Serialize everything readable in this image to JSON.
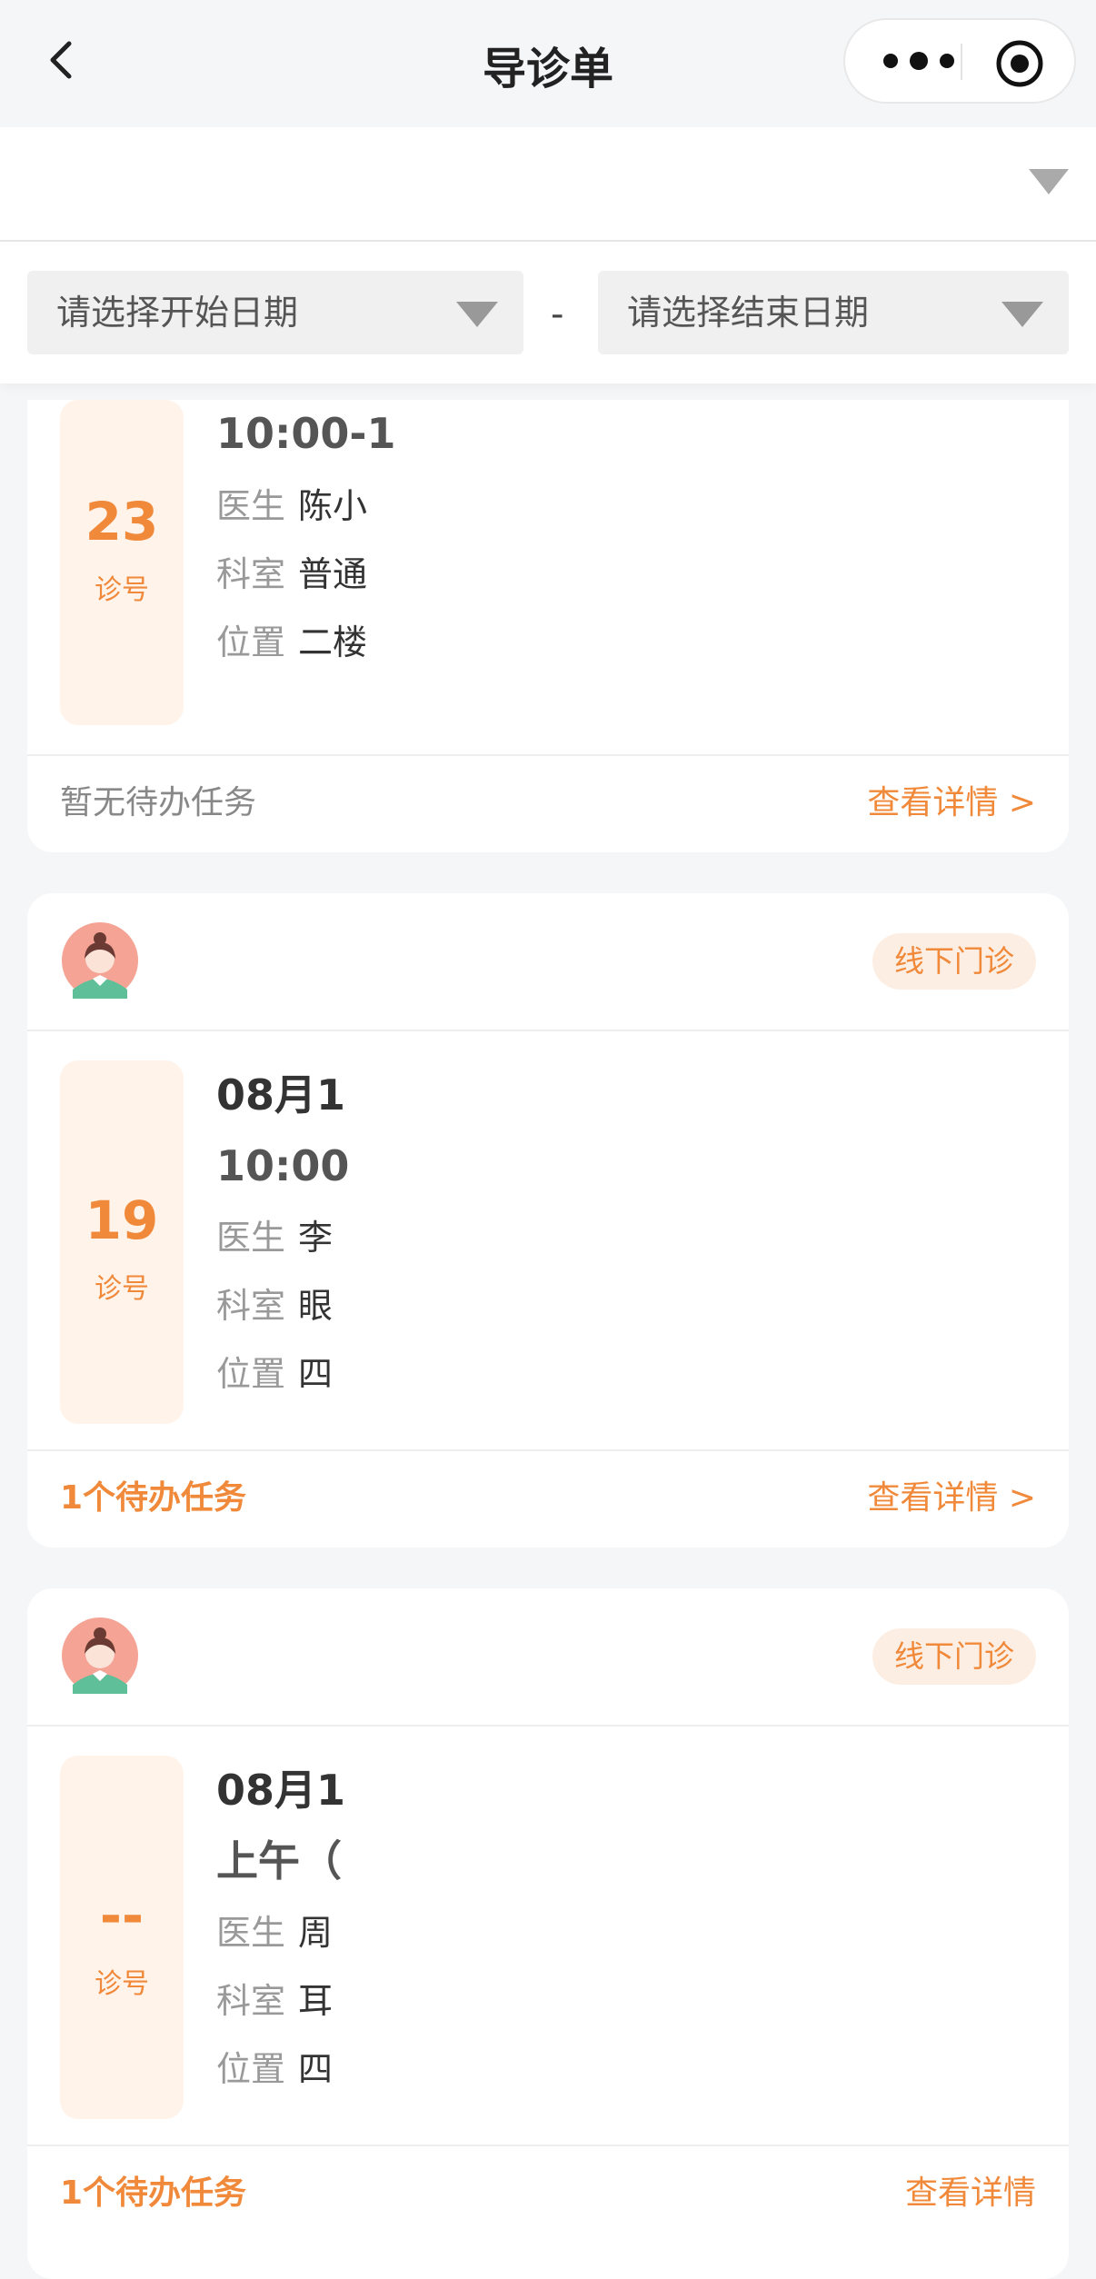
{
  "header": {
    "title": "导诊单"
  },
  "filter": {
    "start_placeholder": "请选择开始日期",
    "separator": "-",
    "end_placeholder": "请选择结束日期"
  },
  "cards": [
    {
      "number": "23",
      "number_label": "诊号",
      "time": "10:00-1",
      "doctor_key": "医生",
      "doctor": "陈小",
      "dept_key": "科室",
      "dept": "普通",
      "loc_key": "位置",
      "loc": "二楼",
      "task_text": "暂无待办任务",
      "detail_link": "查看详情 >"
    },
    {
      "tag": "线下门诊",
      "number": "19",
      "number_label": "诊号",
      "date": "08月1",
      "time": "10:00",
      "doctor_key": "医生",
      "doctor": "李",
      "dept_key": "科室",
      "dept": "眼",
      "loc_key": "位置",
      "loc": "四",
      "task_text": "1个待办任务",
      "detail_link": "查看详情 >"
    },
    {
      "tag": "线下门诊",
      "number": "--",
      "number_label": "诊号",
      "date": "08月1",
      "time": "上午（",
      "doctor_key": "医生",
      "doctor": "周",
      "dept_key": "科室",
      "dept": "耳",
      "loc_key": "位置",
      "loc": "四",
      "task_text": "1个待办任务",
      "detail_link": "查看详情"
    }
  ],
  "colors": {
    "accent": "#f0893a",
    "tag_bg": "#fdeee3",
    "numbox_bg": "#fff3ea"
  }
}
